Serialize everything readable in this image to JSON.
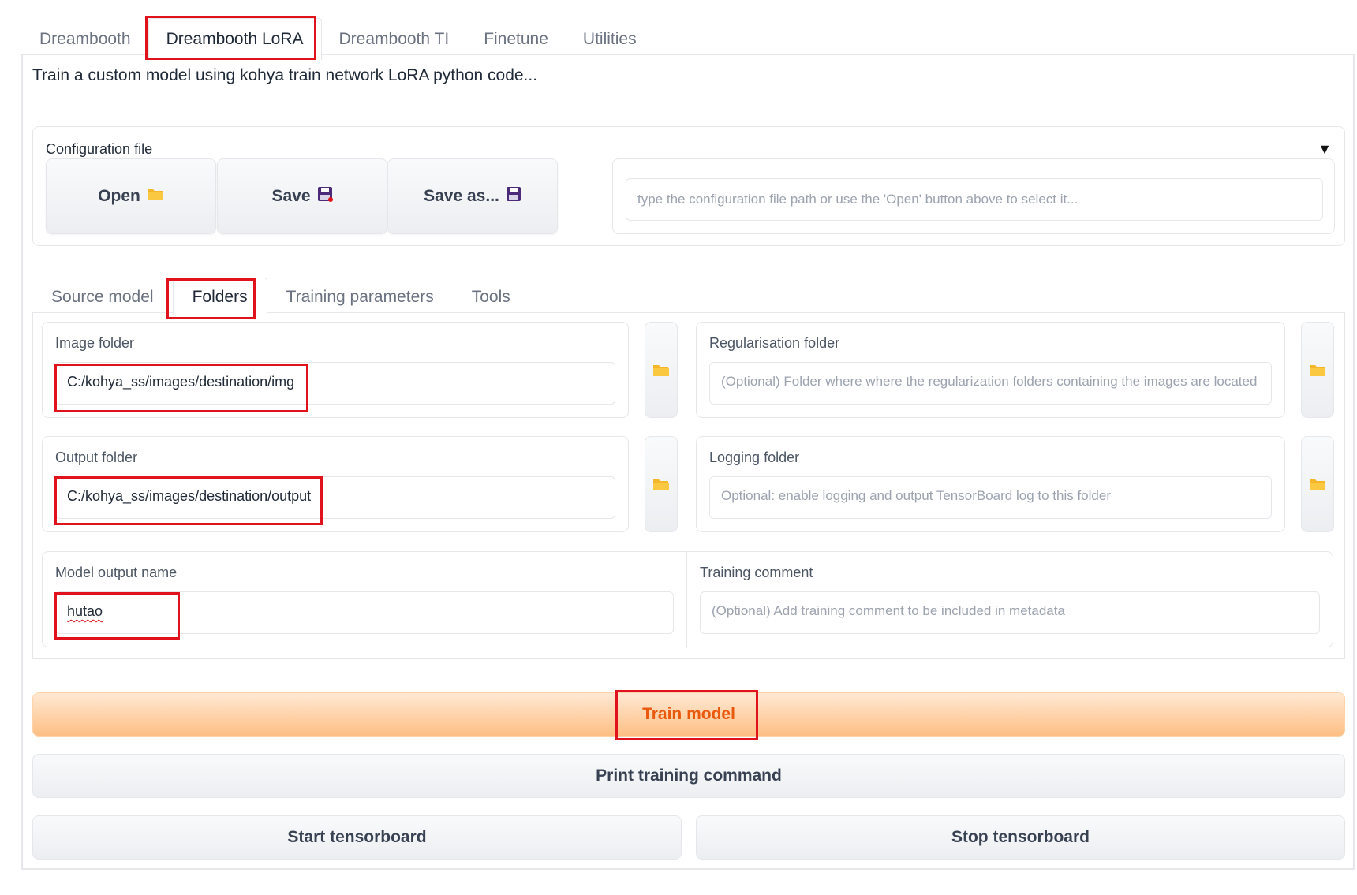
{
  "top_tabs": [
    "Dreambooth",
    "Dreambooth LoRA",
    "Dreambooth TI",
    "Finetune",
    "Utilities"
  ],
  "description": "Train a custom model using kohya train network LoRA python code...",
  "config": {
    "label": "Configuration file",
    "open_label": "Open",
    "save_label": "Save",
    "save_as_label": "Save as...",
    "path_placeholder": "type the configuration file path or use the 'Open' button above to select it...",
    "colors": {
      "folder": "#f5b72a",
      "floppy": "#4b2a7a",
      "floppy_dot": "#e0121b"
    }
  },
  "sub_tabs": [
    "Source model",
    "Folders",
    "Training parameters",
    "Tools"
  ],
  "folders": {
    "image_folder": {
      "label": "Image folder",
      "value": "C:/kohya_ss/images/destination/img"
    },
    "reg_folder": {
      "label": "Regularisation folder",
      "placeholder": "(Optional) Folder where where the regularization folders containing the images are located"
    },
    "output_folder": {
      "label": "Output folder",
      "value": "C:/kohya_ss/images/destination/output"
    },
    "logging_folder": {
      "label": "Logging folder",
      "placeholder": "Optional: enable logging and output TensorBoard log to this folder"
    },
    "model_output_name": {
      "label": "Model output name",
      "value": "hutao"
    },
    "training_comment": {
      "label": "Training comment",
      "placeholder": "(Optional) Add training comment to be included in metadata"
    }
  },
  "actions": {
    "train": "Train model",
    "print": "Print training command",
    "start_tb": "Start tensorboard",
    "stop_tb": "Stop tensorboard"
  },
  "highlight_color": "#e0121b"
}
